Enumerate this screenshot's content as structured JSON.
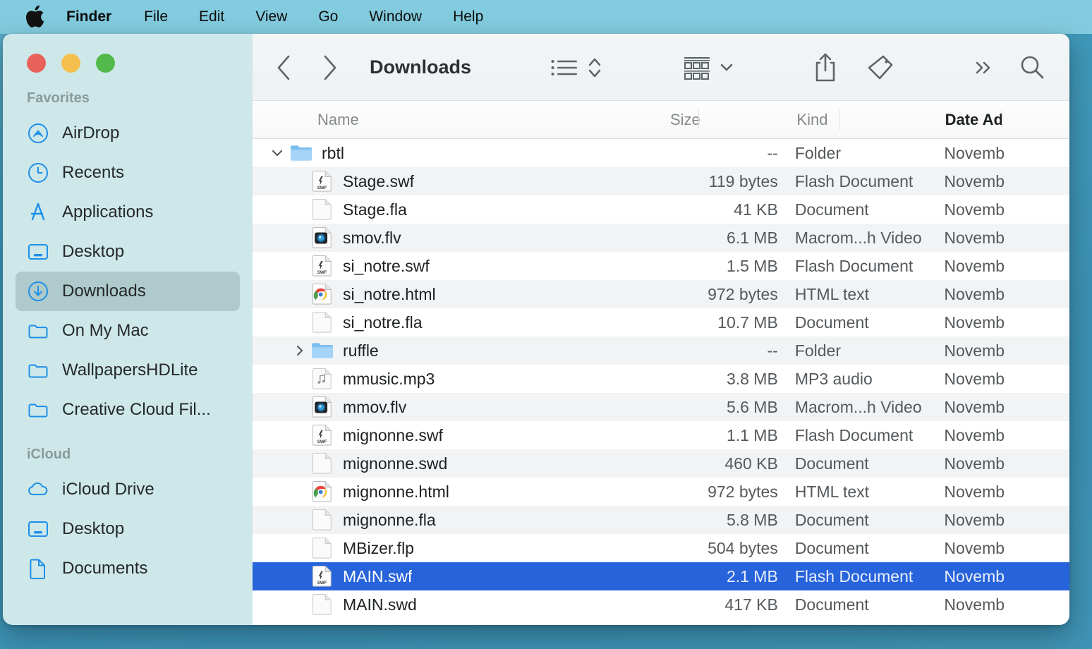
{
  "menubar": {
    "apple_icon": "apple-logo",
    "items": [
      {
        "label": "Finder",
        "bold": true
      },
      {
        "label": "File",
        "bold": false
      },
      {
        "label": "Edit",
        "bold": false
      },
      {
        "label": "View",
        "bold": false
      },
      {
        "label": "Go",
        "bold": false
      },
      {
        "label": "Window",
        "bold": false
      },
      {
        "label": "Help",
        "bold": false
      }
    ]
  },
  "window": {
    "traffic_lights": {
      "close": "close-button",
      "minimize": "minimize-button",
      "zoom": "zoom-button",
      "close_color": "#e8615a",
      "minimize_color": "#f5bf4f",
      "zoom_color": "#52ba4a"
    }
  },
  "sidebar": {
    "sections": [
      {
        "title": "Favorites",
        "items": [
          {
            "label": "AirDrop",
            "icon": "airdrop-icon",
            "selected": false
          },
          {
            "label": "Recents",
            "icon": "clock-icon",
            "selected": false
          },
          {
            "label": "Applications",
            "icon": "app-store-icon",
            "selected": false
          },
          {
            "label": "Desktop",
            "icon": "desktop-icon",
            "selected": false
          },
          {
            "label": "Downloads",
            "icon": "download-icon",
            "selected": true
          },
          {
            "label": "On My Mac",
            "icon": "folder-icon",
            "selected": false
          },
          {
            "label": "WallpapersHDLite",
            "icon": "folder-icon",
            "selected": false
          },
          {
            "label": "Creative Cloud Fil...",
            "icon": "folder-icon",
            "selected": false
          }
        ]
      },
      {
        "title": "iCloud",
        "items": [
          {
            "label": "iCloud Drive",
            "icon": "cloud-icon",
            "selected": false
          },
          {
            "label": "Desktop",
            "icon": "desktop-icon",
            "selected": false
          },
          {
            "label": "Documents",
            "icon": "document-icon",
            "selected": false
          }
        ]
      }
    ]
  },
  "toolbar": {
    "back_icon": "chevron-left-icon",
    "forward_icon": "chevron-right-icon",
    "title": "Downloads",
    "list_view_icon": "list-view-icon",
    "sort_icon": "sort-updown-icon",
    "group_icon": "group-by-icon",
    "group_chevron_icon": "chevron-down-icon",
    "share_icon": "share-icon",
    "tag_icon": "tag-icon",
    "more_icon": "more-chevrons-icon",
    "search_icon": "search-icon"
  },
  "columns": [
    {
      "label": "Name",
      "active": false
    },
    {
      "label": "Size",
      "active": false
    },
    {
      "label": "Kind",
      "active": false
    },
    {
      "label": "Date Ad",
      "active": true
    }
  ],
  "files": [
    {
      "name": "rbtl",
      "size": "--",
      "kind": "Folder",
      "date": "Novemb",
      "icon": "folder-icon",
      "twisty": "down",
      "depth": 0,
      "alt": false,
      "selected": false
    },
    {
      "name": "Stage.swf",
      "size": "119 bytes",
      "kind": "Flash Document",
      "date": "Novemb",
      "icon": "swf-icon",
      "twisty": "none",
      "depth": 1,
      "alt": true,
      "selected": false
    },
    {
      "name": "Stage.fla",
      "size": "41 KB",
      "kind": "Document",
      "date": "Novemb",
      "icon": "blank-doc-icon",
      "twisty": "none",
      "depth": 1,
      "alt": false,
      "selected": false
    },
    {
      "name": "smov.flv",
      "size": "6.1 MB",
      "kind": "Macrom...h Video",
      "date": "Novemb",
      "icon": "flv-icon",
      "twisty": "none",
      "depth": 1,
      "alt": true,
      "selected": false
    },
    {
      "name": "si_notre.swf",
      "size": "1.5 MB",
      "kind": "Flash Document",
      "date": "Novemb",
      "icon": "swf-icon",
      "twisty": "none",
      "depth": 1,
      "alt": false,
      "selected": false
    },
    {
      "name": "si_notre.html",
      "size": "972 bytes",
      "kind": "HTML text",
      "date": "Novemb",
      "icon": "chrome-icon",
      "twisty": "none",
      "depth": 1,
      "alt": true,
      "selected": false
    },
    {
      "name": "si_notre.fla",
      "size": "10.7 MB",
      "kind": "Document",
      "date": "Novemb",
      "icon": "blank-doc-icon",
      "twisty": "none",
      "depth": 1,
      "alt": false,
      "selected": false
    },
    {
      "name": "ruffle",
      "size": "--",
      "kind": "Folder",
      "date": "Novemb",
      "icon": "folder-icon",
      "twisty": "right",
      "depth": 1,
      "alt": true,
      "selected": false
    },
    {
      "name": "mmusic.mp3",
      "size": "3.8 MB",
      "kind": "MP3 audio",
      "date": "Novemb",
      "icon": "music-icon",
      "twisty": "none",
      "depth": 1,
      "alt": false,
      "selected": false
    },
    {
      "name": "mmov.flv",
      "size": "5.6 MB",
      "kind": "Macrom...h Video",
      "date": "Novemb",
      "icon": "flv-icon",
      "twisty": "none",
      "depth": 1,
      "alt": true,
      "selected": false
    },
    {
      "name": "mignonne.swf",
      "size": "1.1 MB",
      "kind": "Flash Document",
      "date": "Novemb",
      "icon": "swf-icon",
      "twisty": "none",
      "depth": 1,
      "alt": false,
      "selected": false
    },
    {
      "name": "mignonne.swd",
      "size": "460 KB",
      "kind": "Document",
      "date": "Novemb",
      "icon": "blank-doc-icon",
      "twisty": "none",
      "depth": 1,
      "alt": true,
      "selected": false
    },
    {
      "name": "mignonne.html",
      "size": "972 bytes",
      "kind": "HTML text",
      "date": "Novemb",
      "icon": "chrome-icon",
      "twisty": "none",
      "depth": 1,
      "alt": false,
      "selected": false
    },
    {
      "name": "mignonne.fla",
      "size": "5.8 MB",
      "kind": "Document",
      "date": "Novemb",
      "icon": "blank-doc-icon",
      "twisty": "none",
      "depth": 1,
      "alt": true,
      "selected": false
    },
    {
      "name": "MBizer.flp",
      "size": "504 bytes",
      "kind": "Document",
      "date": "Novemb",
      "icon": "blank-doc-icon",
      "twisty": "none",
      "depth": 1,
      "alt": false,
      "selected": false
    },
    {
      "name": "MAIN.swf",
      "size": "2.1 MB",
      "kind": "Flash Document",
      "date": "Novemb",
      "icon": "swf-icon",
      "twisty": "none",
      "depth": 1,
      "alt": true,
      "selected": true
    },
    {
      "name": "MAIN.swd",
      "size": "417 KB",
      "kind": "Document",
      "date": "Novemb",
      "icon": "blank-doc-icon",
      "twisty": "none",
      "depth": 1,
      "alt": false,
      "selected": false
    }
  ],
  "colors": {
    "menubar": "#83ccdf",
    "desktop": "#3f97b8",
    "sidebar": "#cee8e9",
    "selection": "#2764db",
    "accent_blue": "#1e8fe8"
  }
}
